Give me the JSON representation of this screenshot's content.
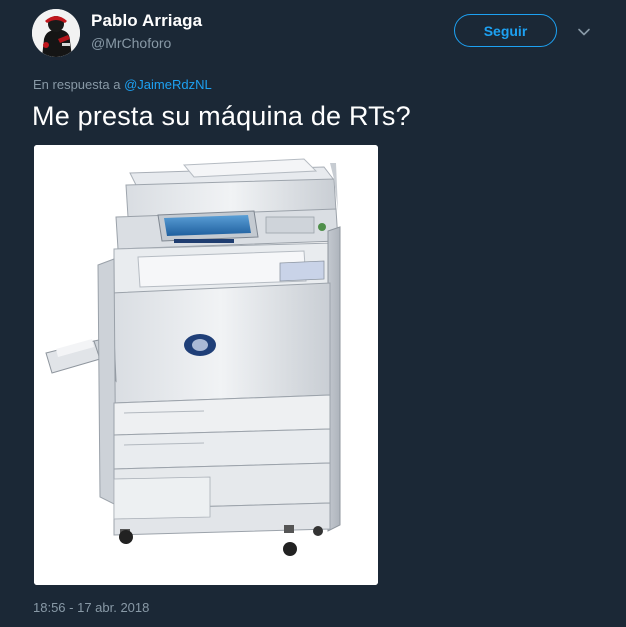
{
  "user": {
    "name": "Pablo Arriaga",
    "handle": "@MrChoforo"
  },
  "actions": {
    "follow_label": "Seguir",
    "more_icon": "chevron-down-icon"
  },
  "reply": {
    "prefix": "En respuesta a",
    "mention": "@JaimeRdzNL"
  },
  "tweet": {
    "text": "Me presta su máquina de RTs?",
    "timestamp": "18:56 - 17 abr. 2018"
  },
  "media": {
    "icon": "photocopier-image"
  },
  "colors": {
    "background": "#1b2836",
    "accent": "#1da1f2",
    "secondary_text": "#8899a6",
    "primary_text": "#ffffff"
  }
}
